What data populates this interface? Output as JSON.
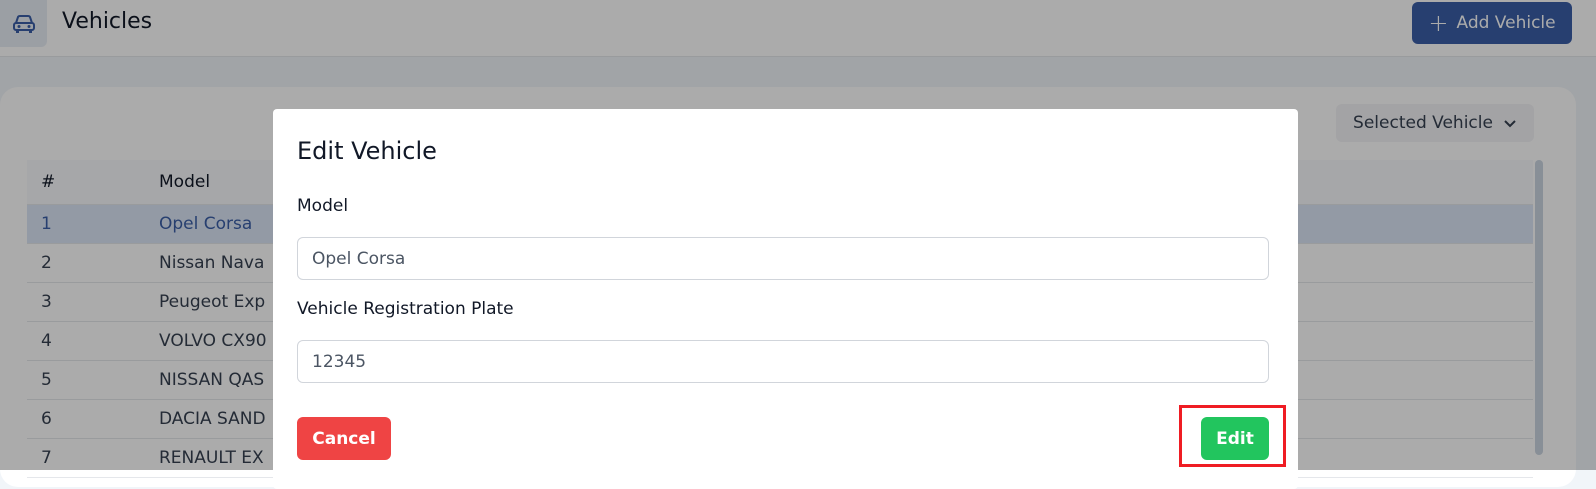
{
  "header": {
    "title": "Vehicles",
    "app_icon": "car-icon",
    "add_button_label": "Add Vehicle",
    "add_button_icon": "plus-icon"
  },
  "filter": {
    "selected_label": "Selected Vehicle",
    "icon": "chevron-down-icon"
  },
  "table": {
    "columns": [
      "#",
      "Model"
    ],
    "rows": [
      {
        "num": "1",
        "model": "Opel Corsa",
        "selected": true
      },
      {
        "num": "2",
        "model": "Nissan Nava"
      },
      {
        "num": "3",
        "model": "Peugeot Exp"
      },
      {
        "num": "4",
        "model": "VOLVO CX90"
      },
      {
        "num": "5",
        "model": "NISSAN QAS"
      },
      {
        "num": "6",
        "model": "DACIA SAND"
      },
      {
        "num": "7",
        "model": "RENAULT EX"
      }
    ]
  },
  "modal": {
    "title": "Edit Vehicle",
    "model_label": "Model",
    "model_value": "Opel Corsa",
    "plate_label": "Vehicle Registration Plate",
    "plate_value": "12345",
    "cancel_label": "Cancel",
    "edit_label": "Edit"
  },
  "colors": {
    "primary": "#3b5fa8",
    "danger": "#ef4444",
    "success": "#22c55e",
    "highlight": "#ef1c23"
  }
}
